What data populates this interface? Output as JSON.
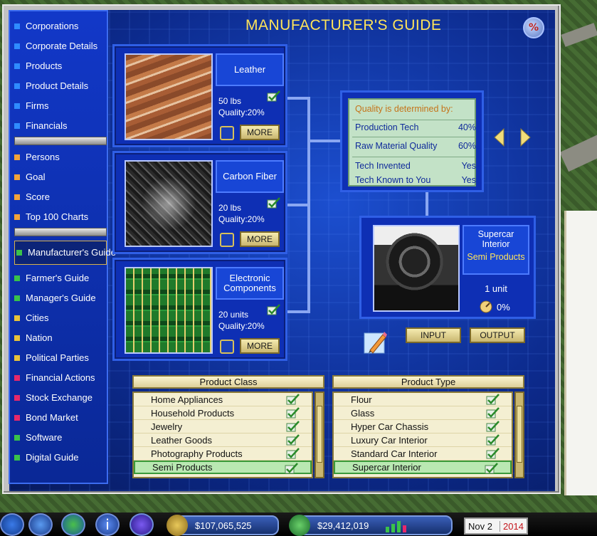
{
  "title": "MANUFACTURER'S GUIDE",
  "sidebar": {
    "groups": [
      {
        "items": [
          {
            "label": "Corporations",
            "color": "#2f8cff"
          },
          {
            "label": "Corporate Details",
            "color": "#2f8cff"
          },
          {
            "label": "Products",
            "color": "#2f8cff"
          },
          {
            "label": "Product Details",
            "color": "#2f8cff"
          },
          {
            "label": "Firms",
            "color": "#2f8cff"
          },
          {
            "label": "Financials",
            "color": "#2f8cff"
          }
        ]
      },
      {
        "items": [
          {
            "label": "Persons",
            "color": "#f2a23a"
          },
          {
            "label": "Goal",
            "color": "#f2a23a"
          },
          {
            "label": "Score",
            "color": "#f2a23a"
          },
          {
            "label": "Top 100 Charts",
            "color": "#f2a23a"
          }
        ]
      },
      {
        "items": [
          {
            "label": "Manufacturer's Guide",
            "color": "#3ac24a",
            "active": true
          },
          {
            "label": "Farmer's Guide",
            "color": "#3ac24a"
          },
          {
            "label": "Manager's Guide",
            "color": "#3ac24a"
          }
        ]
      },
      {
        "items": [
          {
            "label": "Cities",
            "color": "#e8c23a"
          },
          {
            "label": "Nation",
            "color": "#e8c23a"
          },
          {
            "label": "Political Parties",
            "color": "#e8c23a"
          },
          {
            "label": "Financial Actions",
            "color": "#e8286a"
          },
          {
            "label": "Stock Exchange",
            "color": "#e8286a"
          },
          {
            "label": "Bond Market",
            "color": "#e8286a"
          },
          {
            "label": "Software",
            "color": "#3ac24a"
          },
          {
            "label": "Digital Guide",
            "color": "#3ac24a"
          }
        ]
      }
    ]
  },
  "inputs": [
    {
      "name": "Leather",
      "qty": "50 lbs",
      "quality": "Quality:20%",
      "more": "MORE"
    },
    {
      "name": "Carbon Fiber",
      "qty": "20 lbs",
      "quality": "Quality:20%",
      "more": "MORE"
    },
    {
      "name": "Electronic Components",
      "qty": "20 units",
      "quality": "Quality:20%",
      "more": "MORE"
    }
  ],
  "quality_panel": {
    "header": "Quality is determined by:",
    "rows": [
      {
        "label": "Production Tech",
        "value": "40%"
      },
      {
        "label": "Raw Material Quality",
        "value": "60%"
      },
      {
        "label": "Tech Invented",
        "value": "Yes"
      },
      {
        "label": "Tech Known to You",
        "value": "Yes"
      }
    ]
  },
  "product": {
    "name": "Supercar Interior",
    "class": "Semi Products",
    "units": "1 unit",
    "percent": "0%"
  },
  "buttons": {
    "input": "INPUT",
    "output": "OUTPUT"
  },
  "product_class": {
    "header": "Product Class",
    "items": [
      "Home Appliances",
      "Household Products",
      "Jewelry",
      "Leather Goods",
      "Photography Products",
      "Semi Products"
    ],
    "selected": "Semi Products"
  },
  "product_type": {
    "header": "Product Type",
    "items": [
      "Flour",
      "Glass",
      "Hyper Car Chassis",
      "Luxury Car Interior",
      "Standard Car Interior",
      "Supercar Interior"
    ],
    "selected": "Supercar Interior"
  },
  "taskbar": {
    "cash": "$107,065,525",
    "profit": "$29,412,019",
    "date_md": "Nov 2",
    "date_year": "2014"
  }
}
